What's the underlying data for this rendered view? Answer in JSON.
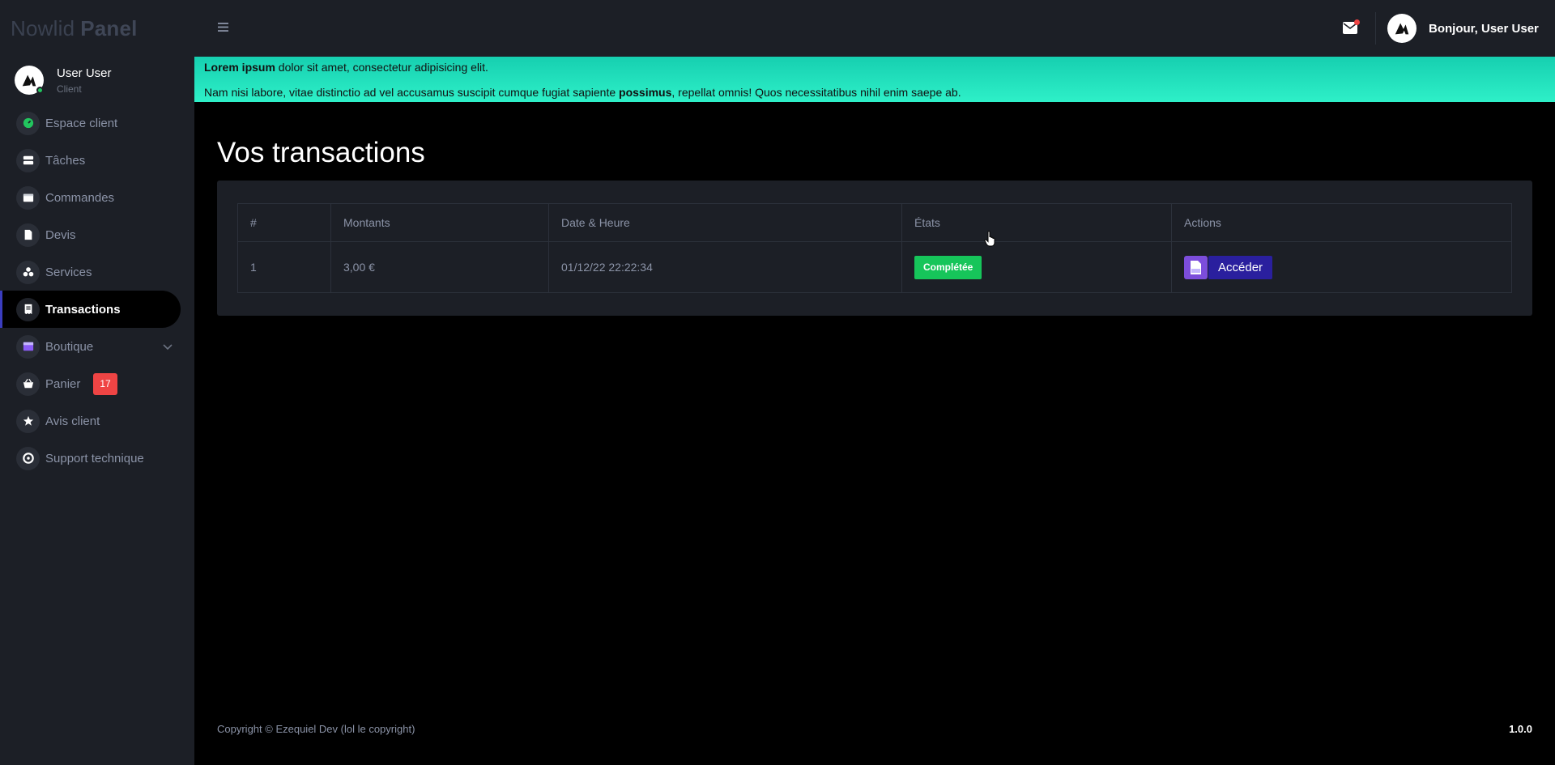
{
  "brand": {
    "part1": "Nowlid",
    "part2": "Panel"
  },
  "user": {
    "name": "User User",
    "role": "Client"
  },
  "nav": [
    {
      "label": "Espace client",
      "icon": "dashboard-icon"
    },
    {
      "label": "Tâches",
      "icon": "tasks-icon"
    },
    {
      "label": "Commandes",
      "icon": "box-icon"
    },
    {
      "label": "Devis",
      "icon": "document-icon"
    },
    {
      "label": "Services",
      "icon": "services-icon"
    },
    {
      "label": "Transactions",
      "icon": "receipt-icon",
      "active": true
    },
    {
      "label": "Boutique",
      "icon": "shop-icon",
      "has_children": true
    },
    {
      "label": "Panier",
      "icon": "basket-icon",
      "badge": "17"
    },
    {
      "label": "Avis client",
      "icon": "star-icon"
    },
    {
      "label": "Support technique",
      "icon": "lifebuoy-icon"
    }
  ],
  "topbar": {
    "greeting": "Bonjour, User User"
  },
  "banner": {
    "line1_bold": "Lorem ipsum",
    "line1_rest": " dolor sit amet, consectetur adipisicing elit.",
    "line2_start": "Nam nisi labore, vitae distinctio ad vel accusamus suscipit cumque fugiat sapiente ",
    "line2_bold": "possimus",
    "line2_end": ", repellat omnis! Quos necessitatibus nihil enim saepe ab."
  },
  "page": {
    "title": "Vos transactions"
  },
  "table": {
    "headers": [
      "#",
      "Montants",
      "Date & Heure",
      "États",
      "Actions"
    ],
    "rows": [
      {
        "id": "1",
        "amount": "3,00 €",
        "datetime": "01/12/22 22:22:34",
        "status": "Complétée",
        "action_label": "Accéder"
      }
    ]
  },
  "footer": {
    "copyright": "Copyright © Ezequiel Dev (lol le copyright)",
    "version": "1.0.0"
  },
  "colors": {
    "sidebar_bg": "#1c1f26",
    "banner": "#2ef0c8",
    "status_completed": "#16c55a",
    "pdf_button": "#7c4ddb",
    "primary_button": "#2a1f9e",
    "badge": "#ef4444"
  }
}
